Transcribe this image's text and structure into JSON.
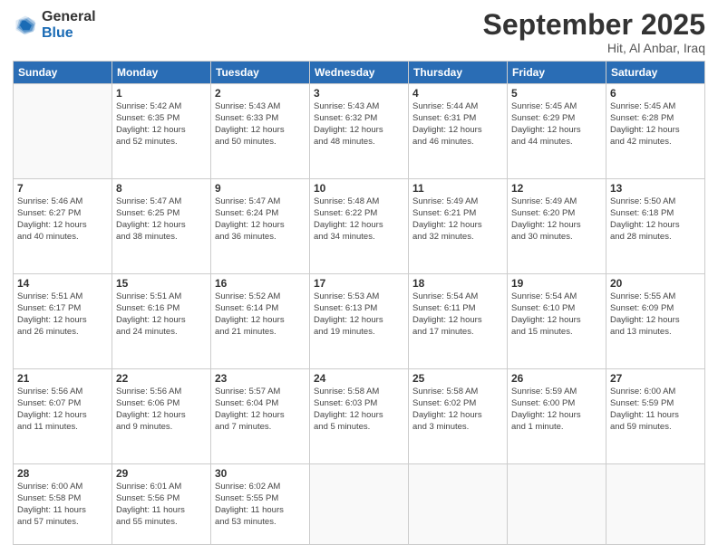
{
  "header": {
    "logo_general": "General",
    "logo_blue": "Blue",
    "month_title": "September 2025",
    "location": "Hit, Al Anbar, Iraq"
  },
  "days_of_week": [
    "Sunday",
    "Monday",
    "Tuesday",
    "Wednesday",
    "Thursday",
    "Friday",
    "Saturday"
  ],
  "weeks": [
    [
      {
        "day": "",
        "info": ""
      },
      {
        "day": "1",
        "info": "Sunrise: 5:42 AM\nSunset: 6:35 PM\nDaylight: 12 hours\nand 52 minutes."
      },
      {
        "day": "2",
        "info": "Sunrise: 5:43 AM\nSunset: 6:33 PM\nDaylight: 12 hours\nand 50 minutes."
      },
      {
        "day": "3",
        "info": "Sunrise: 5:43 AM\nSunset: 6:32 PM\nDaylight: 12 hours\nand 48 minutes."
      },
      {
        "day": "4",
        "info": "Sunrise: 5:44 AM\nSunset: 6:31 PM\nDaylight: 12 hours\nand 46 minutes."
      },
      {
        "day": "5",
        "info": "Sunrise: 5:45 AM\nSunset: 6:29 PM\nDaylight: 12 hours\nand 44 minutes."
      },
      {
        "day": "6",
        "info": "Sunrise: 5:45 AM\nSunset: 6:28 PM\nDaylight: 12 hours\nand 42 minutes."
      }
    ],
    [
      {
        "day": "7",
        "info": "Sunrise: 5:46 AM\nSunset: 6:27 PM\nDaylight: 12 hours\nand 40 minutes."
      },
      {
        "day": "8",
        "info": "Sunrise: 5:47 AM\nSunset: 6:25 PM\nDaylight: 12 hours\nand 38 minutes."
      },
      {
        "day": "9",
        "info": "Sunrise: 5:47 AM\nSunset: 6:24 PM\nDaylight: 12 hours\nand 36 minutes."
      },
      {
        "day": "10",
        "info": "Sunrise: 5:48 AM\nSunset: 6:22 PM\nDaylight: 12 hours\nand 34 minutes."
      },
      {
        "day": "11",
        "info": "Sunrise: 5:49 AM\nSunset: 6:21 PM\nDaylight: 12 hours\nand 32 minutes."
      },
      {
        "day": "12",
        "info": "Sunrise: 5:49 AM\nSunset: 6:20 PM\nDaylight: 12 hours\nand 30 minutes."
      },
      {
        "day": "13",
        "info": "Sunrise: 5:50 AM\nSunset: 6:18 PM\nDaylight: 12 hours\nand 28 minutes."
      }
    ],
    [
      {
        "day": "14",
        "info": "Sunrise: 5:51 AM\nSunset: 6:17 PM\nDaylight: 12 hours\nand 26 minutes."
      },
      {
        "day": "15",
        "info": "Sunrise: 5:51 AM\nSunset: 6:16 PM\nDaylight: 12 hours\nand 24 minutes."
      },
      {
        "day": "16",
        "info": "Sunrise: 5:52 AM\nSunset: 6:14 PM\nDaylight: 12 hours\nand 21 minutes."
      },
      {
        "day": "17",
        "info": "Sunrise: 5:53 AM\nSunset: 6:13 PM\nDaylight: 12 hours\nand 19 minutes."
      },
      {
        "day": "18",
        "info": "Sunrise: 5:54 AM\nSunset: 6:11 PM\nDaylight: 12 hours\nand 17 minutes."
      },
      {
        "day": "19",
        "info": "Sunrise: 5:54 AM\nSunset: 6:10 PM\nDaylight: 12 hours\nand 15 minutes."
      },
      {
        "day": "20",
        "info": "Sunrise: 5:55 AM\nSunset: 6:09 PM\nDaylight: 12 hours\nand 13 minutes."
      }
    ],
    [
      {
        "day": "21",
        "info": "Sunrise: 5:56 AM\nSunset: 6:07 PM\nDaylight: 12 hours\nand 11 minutes."
      },
      {
        "day": "22",
        "info": "Sunrise: 5:56 AM\nSunset: 6:06 PM\nDaylight: 12 hours\nand 9 minutes."
      },
      {
        "day": "23",
        "info": "Sunrise: 5:57 AM\nSunset: 6:04 PM\nDaylight: 12 hours\nand 7 minutes."
      },
      {
        "day": "24",
        "info": "Sunrise: 5:58 AM\nSunset: 6:03 PM\nDaylight: 12 hours\nand 5 minutes."
      },
      {
        "day": "25",
        "info": "Sunrise: 5:58 AM\nSunset: 6:02 PM\nDaylight: 12 hours\nand 3 minutes."
      },
      {
        "day": "26",
        "info": "Sunrise: 5:59 AM\nSunset: 6:00 PM\nDaylight: 12 hours\nand 1 minute."
      },
      {
        "day": "27",
        "info": "Sunrise: 6:00 AM\nSunset: 5:59 PM\nDaylight: 11 hours\nand 59 minutes."
      }
    ],
    [
      {
        "day": "28",
        "info": "Sunrise: 6:00 AM\nSunset: 5:58 PM\nDaylight: 11 hours\nand 57 minutes."
      },
      {
        "day": "29",
        "info": "Sunrise: 6:01 AM\nSunset: 5:56 PM\nDaylight: 11 hours\nand 55 minutes."
      },
      {
        "day": "30",
        "info": "Sunrise: 6:02 AM\nSunset: 5:55 PM\nDaylight: 11 hours\nand 53 minutes."
      },
      {
        "day": "",
        "info": ""
      },
      {
        "day": "",
        "info": ""
      },
      {
        "day": "",
        "info": ""
      },
      {
        "day": "",
        "info": ""
      }
    ]
  ]
}
